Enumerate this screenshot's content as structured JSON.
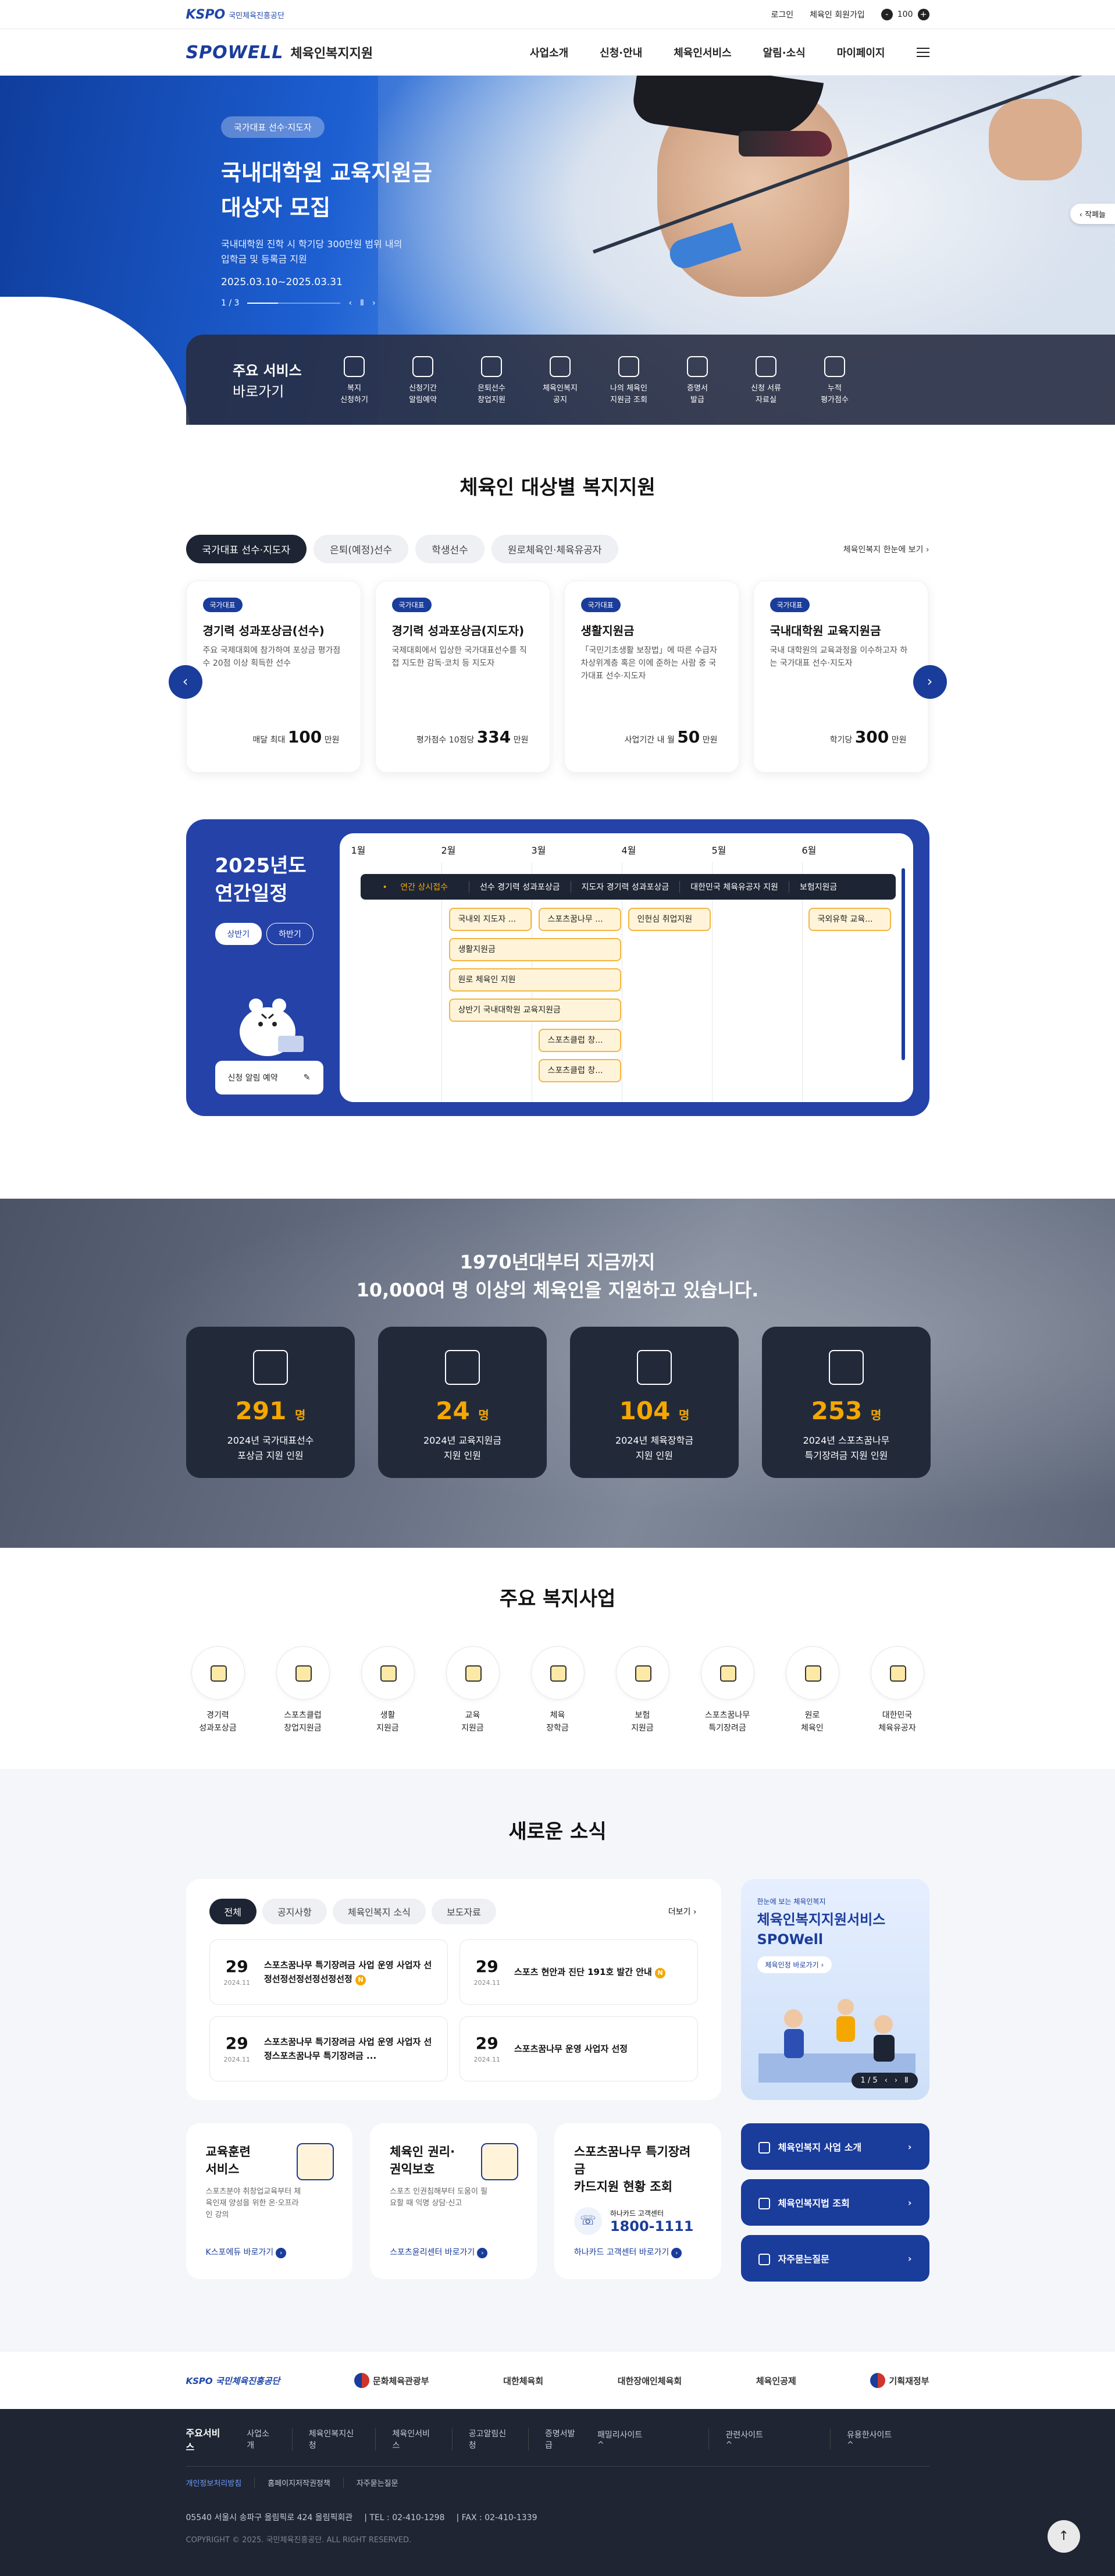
{
  "util": {
    "org_logo": "KSPO",
    "org_name": "국민체육진흥공단",
    "login": "로그인",
    "join": "체육인 회원가입",
    "font_minus": "-",
    "font_value": "100",
    "font_plus": "+"
  },
  "header": {
    "logo": "SPOWELL",
    "title": "체육인복지지원",
    "menu": [
      "사업소개",
      "신청·안내",
      "체육인서비스",
      "알림·소식",
      "마이페이지"
    ]
  },
  "hero": {
    "tag": "국가대표 선수·지도자",
    "title_line1": "국내대학원 교육지원금",
    "title_line2": "대상자 모집",
    "desc_line1": "국내대학원 진학 시 학기당 300만원 범위 내의",
    "desc_line2": "입학금 및 등록금 지원",
    "date": "2025.03.10~2025.03.31",
    "pager": "1 / 3",
    "progress": 0.33,
    "side_tab": "작폐늘"
  },
  "quick": {
    "title_line1": "주요 서비스",
    "title_line2": "바로가기",
    "items": [
      {
        "l1": "복지",
        "l2": "신청하기"
      },
      {
        "l1": "신청기간",
        "l2": "알림예약"
      },
      {
        "l1": "은퇴선수",
        "l2": "창업지원"
      },
      {
        "l1": "체육인복지",
        "l2": "공지"
      },
      {
        "l1": "나의 체육인",
        "l2": "지원금 조회"
      },
      {
        "l1": "증명서",
        "l2": "발급"
      },
      {
        "l1": "신청 서류",
        "l2": "자료실"
      },
      {
        "l1": "누적",
        "l2": "평가점수"
      }
    ]
  },
  "target": {
    "title": "체육인 대상별 복지지원",
    "tabs": [
      "국가대표 선수·지도자",
      "은퇴(예정)선수",
      "학생선수",
      "원로체육인·체육유공자"
    ],
    "more": "체육인복지 한눈에 보기",
    "cards": [
      {
        "badge": "국가대표",
        "title": "경기력 성과포상금(선수)",
        "desc": "주요 국제대회에 참가하여 포상금 평가점수 20점 이상 획득한 선수",
        "pre": "매달 최대",
        "num": "100",
        "unit": "만원"
      },
      {
        "badge": "국가대표",
        "title": "경기력 성과포상금(지도자)",
        "desc": "국제대회에서 입상한 국가대표선수를 직접 지도한 감독·코치 등 지도자",
        "pre": "평가점수 10점당",
        "num": "334",
        "unit": "만원"
      },
      {
        "badge": "국가대표",
        "title": "생활지원금",
        "desc": "「국민기초생활 보장법」에 따른 수급자 차상위계층 혹은 이에 준하는 사람 중 국가대표 선수·지도자",
        "pre": "사업기간 내 월",
        "num": "50",
        "unit": "만원"
      },
      {
        "badge": "국가대표",
        "title": "국내대학원 교육지원금",
        "desc": "국내 대학원의 교육과정을 이수하고자 하는 국가대표 선수·지도자",
        "pre": "학기당",
        "num": "300",
        "unit": "만원"
      }
    ]
  },
  "schedule": {
    "title_line1": "2025년도",
    "title_line2": "연간일정",
    "half_tabs": [
      "상반기",
      "하반기"
    ],
    "alarm": "신청 알림 예약",
    "months": [
      "1월",
      "2월",
      "3월",
      "4월",
      "5월",
      "6월"
    ],
    "categories": [
      "연간 상시접수",
      "선수 경기력 성과포상금",
      "지도자 경기력 성과포상금",
      "대한민국 체육유공자 지원",
      "보험지원금"
    ],
    "events": [
      {
        "label": "국내외 지도자 ..."
      },
      {
        "label": "스포츠꿈나무 ..."
      },
      {
        "label": "인헌심 취업지원"
      },
      {
        "label": "국외유학 교육..."
      },
      {
        "label": "생활지원금"
      },
      {
        "label": "원로 체육인 지원"
      },
      {
        "label": "상반기 국내대학원 교육지원금"
      },
      {
        "label": "스포츠클럽 창..."
      },
      {
        "label": "스포츠클럽 창..."
      }
    ]
  },
  "stats": {
    "title_line1": "1970년대부터 지금까지",
    "title_line2": "10,000여 명 이상의 체육인을 지원하고 있습니다.",
    "items": [
      {
        "num": "291",
        "unit": "명",
        "l1": "2024년 국가대표선수",
        "l2": "포상금 지원 인원"
      },
      {
        "num": "24",
        "unit": "명",
        "l1": "2024년 교육지원금",
        "l2": "지원 인원"
      },
      {
        "num": "104",
        "unit": "명",
        "l1": "2024년 체육장학금",
        "l2": "지원 인원"
      },
      {
        "num": "253",
        "unit": "명",
        "l1": "2024년 스포츠꿈나무",
        "l2": "특기장려금 지원 인원"
      }
    ]
  },
  "programs": {
    "title": "주요 복지사업",
    "items": [
      {
        "l1": "경기력",
        "l2": "성과포상금"
      },
      {
        "l1": "스포츠클럽",
        "l2": "창업지원금"
      },
      {
        "l1": "생활",
        "l2": "지원금"
      },
      {
        "l1": "교육",
        "l2": "지원금"
      },
      {
        "l1": "체육",
        "l2": "장학금"
      },
      {
        "l1": "보험",
        "l2": "지원금"
      },
      {
        "l1": "스포츠꿈나무",
        "l2": "특기장려금"
      },
      {
        "l1": "원로",
        "l2": "체육인"
      },
      {
        "l1": "대한민국",
        "l2": "체육유공자"
      }
    ]
  },
  "news": {
    "title": "새로운 소식",
    "tabs": [
      "전체",
      "공지사항",
      "체육인복지 소식",
      "보도자료"
    ],
    "more": "더보기",
    "items": [
      {
        "day": "29",
        "ym": "2024.11",
        "title": "스포츠꿈나무 특기장려금 사업 운영 사업자 선정선정선정선정선정선정",
        "n": "N"
      },
      {
        "day": "29",
        "ym": "2024.11",
        "title": "스포츠 현안과 진단 191호 발간 안내",
        "n": "N"
      },
      {
        "day": "29",
        "ym": "2024.11",
        "title": "스포츠꿈나무 특기장려금 사업 운영 사업자 선정스포츠꿈나무 특기장려금 ...",
        "n": ""
      },
      {
        "day": "29",
        "ym": "2024.11",
        "title": "스포츠꿈나무 운영 사업자 선정",
        "n": ""
      }
    ],
    "promo": {
      "small": "한눈에 보는 체육인복지",
      "title_line1": "체육인복지지원서비스",
      "title_line2": "SPOWell",
      "btn": "체육인정 바로가기",
      "pager": "1 / 5"
    }
  },
  "services": [
    {
      "title_line1": "교육훈련",
      "title_line2": "서비스",
      "desc": "스포츠분야 취창업교육부터 체육인재 양성을 위한 온·오프라인 강의",
      "link": "K스포에듀 바로가기"
    },
    {
      "title_line1": "체육인 권리·",
      "title_line2": "권익보호",
      "desc": "스포츠 인권침해부터 도움이 필요할 때 익명 상담·신고",
      "link": "스포츠윤리센터 바로가기"
    },
    {
      "title_line1": "스포츠꿈나무 특기장려금",
      "title_line2": "카드지원 현황 조회",
      "tel_label": "하나카드 고객센터",
      "tel": "1800-1111",
      "link": "하나카드 고객센터 바로가기"
    }
  ],
  "link_buttons": [
    "체육인복지 사업 소개",
    "체육인복지법 조회",
    "자주묻는질문"
  ],
  "partners": [
    "KSPO 국민체육진흥공단",
    "문화체육관광부",
    "대한체육회",
    "대한장애인체육회",
    "체육인공제",
    "기획재정부"
  ],
  "footer": {
    "main": "주요서비스",
    "menu": [
      "사업소개",
      "체육인복지신청",
      "체육인서비스",
      "공고알림신청",
      "증명서발급"
    ],
    "sites": [
      "패밀리사이트",
      "관련사이트",
      "유용한사이트"
    ],
    "policy": [
      "개인정보처리방침",
      "홈페이지저작권정책",
      "자주묻는질문"
    ],
    "address": "05540 서울시 송파구 올림픽로 424 올림픽회관",
    "tel": "TEL : 02-410-1298",
    "fax": "FAX : 02-410-1339",
    "copyright": "COPYRIGHT © 2025. 국민체육진흥공단. ALL RIGHT RESERVED."
  },
  "colors": {
    "brand": "#1a3c9b",
    "accent": "#f5a700",
    "dark": "#1d2433"
  }
}
